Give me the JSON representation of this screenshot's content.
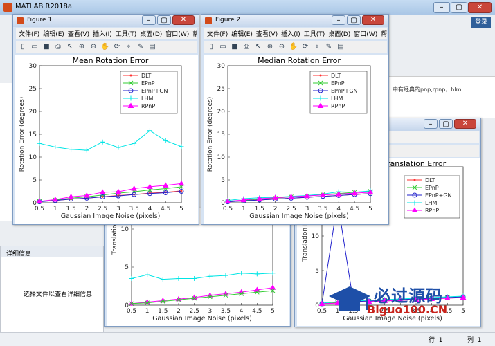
{
  "app": {
    "title": "MATLAB R2018a",
    "login": "登录"
  },
  "window_buttons": {
    "min": "–",
    "max": "▢",
    "close": "✕"
  },
  "detail": {
    "header": "详细信息",
    "message": "选择文件以查看详细信息"
  },
  "notes": {
    "line1": "中有经典的pnp,rpnp，hlm..."
  },
  "status": {
    "row_label": "行",
    "row_value": "1",
    "col_label": "列",
    "col_value": "1"
  },
  "watermark": {
    "text": "必过源码",
    "sub": "Biguo100.CN"
  },
  "figures": [
    {
      "title": "Figure 1"
    },
    {
      "title": "Figure 2"
    }
  ],
  "menu": [
    "文件(F)",
    "编辑(E)",
    "查看(V)",
    "插入(I)",
    "工具(T)",
    "桌面(D)",
    "窗口(W)",
    "帮助(H)"
  ],
  "toolbar_icons": [
    "new-file-icon",
    "open-folder-icon",
    "save-icon",
    "print-icon",
    "pointer-icon",
    "zoom-in-icon",
    "zoom-out-icon",
    "pan-hand-icon",
    "rotate-icon",
    "data-cursor-icon",
    "brush-icon",
    "insert-colorbar-icon"
  ],
  "colors": {
    "DLT": "#ff3333",
    "EPnP": "#33cc33",
    "EPnP+GN": "#2222cc",
    "LHM": "#00e5e5",
    "RPnP": "#ff00ff"
  },
  "chart_data": [
    {
      "type": "line",
      "title": "Mean Rotation Error",
      "xlabel": "Gaussian Image Noise (pixels)",
      "ylabel": "Rotation Error (degrees)",
      "xlim": [
        0.5,
        5
      ],
      "ylim": [
        0,
        30
      ],
      "xticks": [
        "0.5",
        "1",
        "1.5",
        "2",
        "2.5",
        "3",
        "3.5",
        "4",
        "4.5",
        "5"
      ],
      "yticks": [
        "0",
        "5",
        "10",
        "15",
        "20",
        "25",
        "30"
      ],
      "legend": "top-right",
      "x": [
        0.5,
        1,
        1.5,
        2,
        2.5,
        3,
        3.5,
        4,
        4.5,
        5
      ],
      "series": [
        {
          "name": "DLT",
          "marker": "dot",
          "values": [
            0.3,
            0.5,
            0.8,
            1.0,
            1.3,
            1.6,
            1.8,
            2.1,
            2.3,
            2.6
          ]
        },
        {
          "name": "EPnP",
          "marker": "x",
          "values": [
            0.3,
            0.6,
            1.0,
            1.3,
            1.7,
            2.1,
            2.4,
            2.8,
            3.1,
            3.5
          ]
        },
        {
          "name": "EPnP+GN",
          "marker": "circle",
          "values": [
            0.2,
            0.5,
            0.8,
            1.0,
            1.3,
            1.5,
            1.8,
            2.0,
            2.2,
            2.5
          ]
        },
        {
          "name": "LHM",
          "marker": "plus",
          "values": [
            13.0,
            12.2,
            11.7,
            11.5,
            13.3,
            12.1,
            13.0,
            15.8,
            13.6,
            12.3
          ]
        },
        {
          "name": "RPnP",
          "marker": "triangle",
          "values": [
            0.3,
            0.7,
            1.3,
            1.6,
            2.3,
            2.4,
            3.1,
            3.5,
            3.8,
            4.2
          ]
        }
      ]
    },
    {
      "type": "line",
      "title": "Median Rotation Error",
      "xlabel": "Gaussian Image Noise (pixels)",
      "ylabel": "Rotation Error (degrees)",
      "xlim": [
        0.5,
        5
      ],
      "ylim": [
        0,
        30
      ],
      "xticks": [
        "0.5",
        "1",
        "1.5",
        "2",
        "2.5",
        "3",
        "3.5",
        "4",
        "4.5",
        "5"
      ],
      "yticks": [
        "0",
        "5",
        "10",
        "15",
        "20",
        "25",
        "30"
      ],
      "legend": "top-right",
      "x": [
        0.5,
        1,
        1.5,
        2,
        2.5,
        3,
        3.5,
        4,
        4.5,
        5
      ],
      "series": [
        {
          "name": "DLT",
          "marker": "dot",
          "values": [
            0.2,
            0.4,
            0.6,
            0.8,
            1.0,
            1.2,
            1.4,
            1.6,
            1.8,
            2.0
          ]
        },
        {
          "name": "EPnP",
          "marker": "x",
          "values": [
            0.3,
            0.5,
            0.8,
            1.0,
            1.3,
            1.5,
            1.8,
            2.0,
            2.3,
            2.5
          ]
        },
        {
          "name": "EPnP+GN",
          "marker": "circle",
          "values": [
            0.2,
            0.4,
            0.6,
            0.8,
            1.0,
            1.2,
            1.4,
            1.6,
            1.8,
            2.0
          ]
        },
        {
          "name": "LHM",
          "marker": "plus",
          "values": [
            0.5,
            0.9,
            1.1,
            1.2,
            1.4,
            1.6,
            1.9,
            2.4,
            2.3,
            2.6
          ]
        },
        {
          "name": "RPnP",
          "marker": "triangle",
          "values": [
            0.3,
            0.6,
            0.9,
            1.1,
            1.3,
            1.5,
            1.7,
            1.9,
            2.1,
            2.3
          ]
        }
      ]
    },
    {
      "type": "line",
      "title": "",
      "xlabel": "Gaussian Image Noise (pixels)",
      "ylabel": "Translation Error",
      "xlim": [
        0.5,
        5
      ],
      "ylim": [
        0,
        20
      ],
      "xticks": [
        "0.5",
        "1",
        "1.5",
        "2",
        "2.5",
        "3",
        "3.5",
        "4",
        "4.5",
        "5"
      ],
      "yticks": [
        "0",
        "5",
        "10",
        "15"
      ],
      "legend": "none",
      "x": [
        0.5,
        1,
        1.5,
        2,
        2.5,
        3,
        3.5,
        4,
        4.5,
        5
      ],
      "series": [
        {
          "name": "LHM",
          "marker": "plus",
          "values": [
            3.5,
            4.0,
            3.4,
            3.5,
            3.5,
            3.8,
            3.9,
            4.2,
            4.1,
            4.2
          ]
        },
        {
          "name": "RPnP",
          "marker": "triangle",
          "values": [
            0.2,
            0.4,
            0.6,
            0.8,
            1.0,
            1.3,
            1.5,
            1.7,
            2.0,
            2.3
          ]
        },
        {
          "name": "EPnP",
          "marker": "x",
          "values": [
            0.2,
            0.3,
            0.5,
            0.7,
            0.9,
            1.1,
            1.3,
            1.5,
            1.7,
            1.9
          ]
        }
      ]
    },
    {
      "type": "line",
      "title": "Translation Error",
      "xlabel": "Gaussian Image Noise (pixels)",
      "ylabel": "Translation Error",
      "xlim": [
        0.5,
        5
      ],
      "ylim": [
        0,
        20
      ],
      "xticks": [
        "0.5",
        "1",
        "1.5",
        "2",
        "2.5",
        "3",
        "3.5",
        "4",
        "4.5",
        "5"
      ],
      "yticks": [
        "0",
        "5",
        "10",
        "15"
      ],
      "legend": "top-left",
      "x": [
        0.5,
        1,
        1.5,
        2,
        2.5,
        3,
        3.5,
        4,
        4.5,
        5
      ],
      "series": [
        {
          "name": "DLT",
          "marker": "dot",
          "values": [
            0.2,
            0.3,
            0.4,
            0.5,
            0.6,
            0.7,
            0.8,
            0.9,
            1.0,
            1.1
          ]
        },
        {
          "name": "EPnP",
          "marker": "x",
          "values": [
            0.2,
            0.4,
            0.5,
            0.6,
            0.7,
            0.8,
            0.9,
            1.0,
            1.1,
            1.2
          ]
        },
        {
          "name": "EPnP+GN",
          "marker": "circle",
          "values": [
            0.2,
            15.0,
            0.5,
            0.6,
            0.7,
            0.8,
            0.9,
            1.0,
            1.1,
            1.2
          ]
        },
        {
          "name": "LHM",
          "marker": "plus",
          "values": [
            0.3,
            0.5,
            0.6,
            0.7,
            0.8,
            0.9,
            1.0,
            1.1,
            1.2,
            1.3
          ]
        },
        {
          "name": "RPnP",
          "marker": "triangle",
          "values": [
            0.2,
            0.3,
            0.4,
            0.5,
            0.6,
            0.7,
            0.8,
            0.9,
            1.0,
            1.1
          ]
        }
      ]
    }
  ]
}
